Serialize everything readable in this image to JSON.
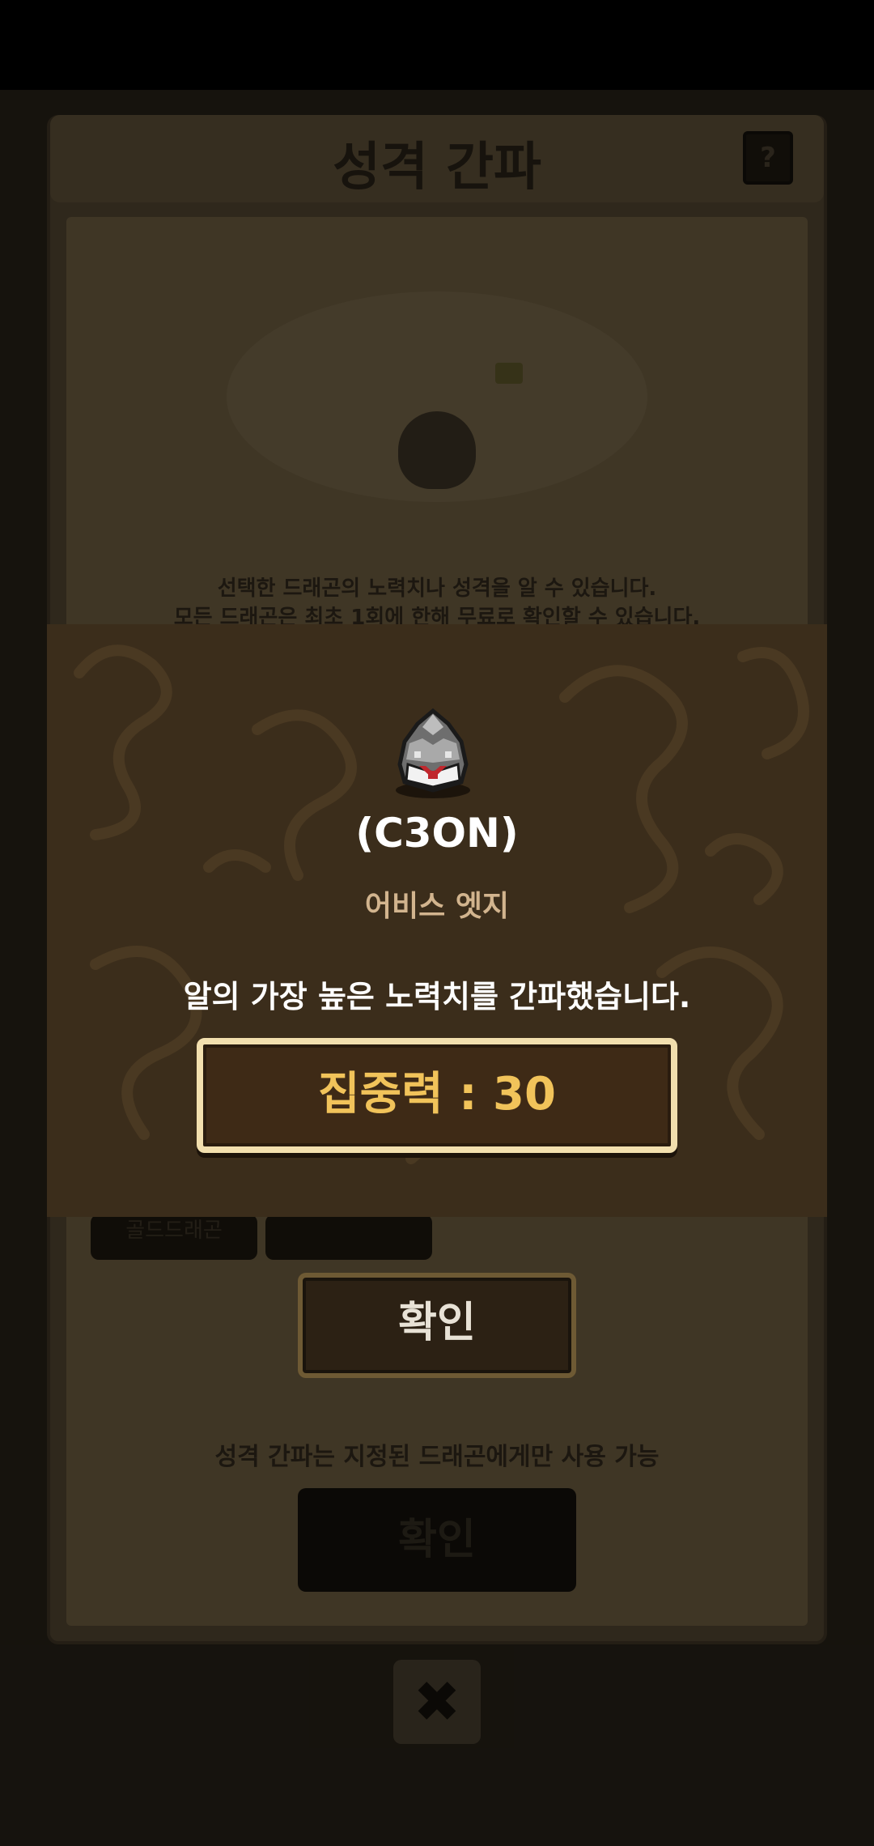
{
  "app": {
    "title": "성격 간파",
    "help_label": "?",
    "desc_line1": "선택한 드래곤의 노력치나 성격을 알 수 있습니다.",
    "desc_line2": "모든 드래곤은 최초 1회에 한해 무료로 확인할 수 있습니다.",
    "tab_gold_dragon": "골드드래곤",
    "confirm_label": "확인",
    "usage_note": "성격 간파는 지정된 드래곤에게만 사용 가능",
    "confirm2_label": "확인",
    "close_icon": "close-x-icon",
    "close_label": "✖"
  },
  "modal": {
    "egg_icon": "dragon-egg-icon",
    "dragon_name": "(C3ON)",
    "dragon_subtitle": "어비스 엣지",
    "message": "알의 가장 높은 노력치를 간파했습니다.",
    "stat_text": "집중력 : 30"
  },
  "colors": {
    "modal_bg": "#3b2d1b",
    "stat_text": "#f1c35a",
    "stat_border": "#f2dfae",
    "subtitle": "#d2b48e"
  }
}
